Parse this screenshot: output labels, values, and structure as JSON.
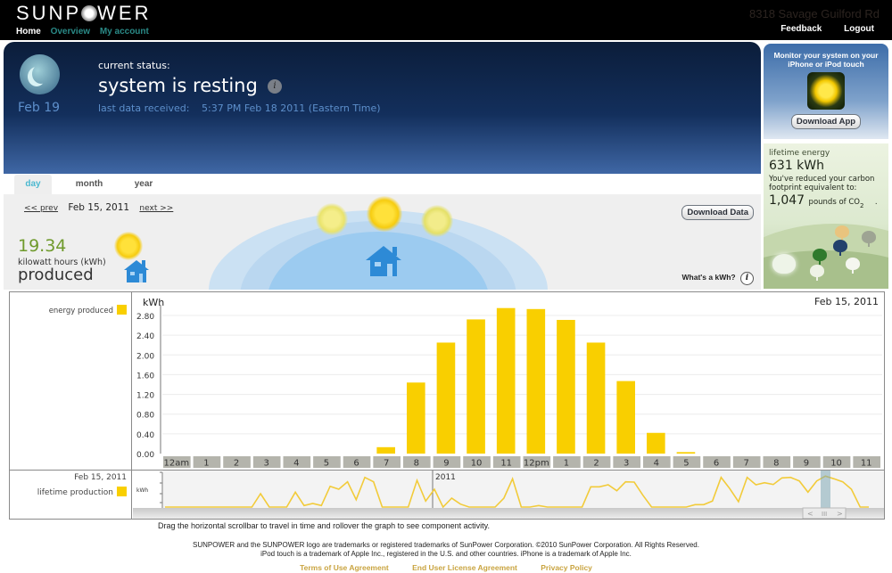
{
  "header": {
    "brand": "SUNPOWER",
    "nav": [
      "Home",
      "Overview",
      "My account"
    ],
    "active_nav": "Home",
    "address": "8318 Savage Guilford Rd",
    "feedback": "Feedback",
    "logout": "Logout"
  },
  "status": {
    "date": "Feb 19",
    "label": "current status:",
    "value": "system is resting",
    "info_icon": "i",
    "last_data_label": "last data received:",
    "last_data_value": "5:37 PM Feb 18 2011 (Eastern Time)"
  },
  "app_promo": {
    "text": "Monitor your system on your iPhone or iPod touch",
    "button": "Download App"
  },
  "lifetime": {
    "title": "lifetime energy",
    "value": "631 kWh",
    "desc": "You've reduced your carbon footprint equivalent to:",
    "co2_value": "1,047",
    "co2_unit": "pounds of CO",
    "co2_sub": "2",
    "co2_tail": "."
  },
  "tabs": [
    {
      "label": "day",
      "active": true
    },
    {
      "label": "month",
      "active": false
    },
    {
      "label": "year",
      "active": false
    }
  ],
  "day": {
    "prev": "<< prev",
    "date": "Feb 15, 2011",
    "next": "next >>",
    "produced_value": "19.34",
    "produced_unit": "kilowatt hours (kWh)",
    "produced_label": "produced",
    "download_data": "Download Data",
    "whats_kwh": "What's a kWh?",
    "info_icon": "i"
  },
  "chart_legend": {
    "energy": "energy produced",
    "mini_date": "Feb 15, 2011",
    "lifetime": "lifetime production",
    "energy_color": "#f9cf00"
  },
  "chart_data": {
    "type": "bar",
    "title": "Feb 15, 2011",
    "ylabel": "kWh",
    "xlabel": "",
    "ylim": [
      0,
      2.8
    ],
    "yticks": [
      "0.00",
      "0.40",
      "0.80",
      "1.20",
      "1.60",
      "2.00",
      "2.40",
      "2.80"
    ],
    "grid": true,
    "legend": "left",
    "categories": [
      "12am",
      "1",
      "2",
      "3",
      "4",
      "5",
      "6",
      "7",
      "8",
      "9",
      "10",
      "11",
      "12pm",
      "1",
      "2",
      "3",
      "4",
      "5",
      "6",
      "7",
      "8",
      "9",
      "10",
      "11"
    ],
    "series": [
      {
        "name": "energy produced",
        "color": "#f9cf00",
        "values": [
          0,
          0,
          0,
          0,
          0,
          0,
          0,
          0.13,
          1.44,
          2.25,
          2.72,
          2.95,
          2.93,
          2.71,
          2.25,
          1.47,
          0.42,
          0.03,
          0,
          0,
          0,
          0,
          0,
          0
        ]
      }
    ]
  },
  "mini_chart": {
    "type": "line",
    "ylabel": "kWh",
    "year_marker": "2011",
    "color": "#f2cb3a",
    "values": [
      0,
      0,
      0,
      0,
      0,
      0,
      0,
      0,
      0,
      0,
      0,
      0.45,
      0,
      0,
      0,
      0.5,
      0.05,
      0.12,
      0.05,
      0.7,
      0.6,
      0.85,
      0.25,
      1,
      0.85,
      0,
      0,
      0,
      0,
      0.9,
      0.2,
      0.6,
      0,
      0.3,
      0.1,
      0,
      0,
      0,
      0,
      0.3,
      0.95,
      0,
      0,
      0.05,
      0,
      0,
      0,
      0,
      0,
      0.68,
      0.68,
      0.75,
      0.55,
      0.85,
      0.84,
      0.4,
      0,
      0,
      0,
      0,
      0,
      0.08,
      0.08,
      0.2,
      1.0,
      0.62,
      0.18,
      1.0,
      0.75,
      0.82,
      0.76,
      0.98,
      1.0,
      0.88,
      0.5,
      0.88,
      1.04,
      0.95,
      0.85,
      0.6,
      0,
      0
    ],
    "scrollbar": {
      "left": "<",
      "grip": "III",
      "right": ">"
    }
  },
  "hint": "Drag the horizontal scrollbar to travel in time and rollover the graph to see component activity.",
  "footer": {
    "line1": "SUNPOWER and the SUNPOWER logo are trademarks or registered trademarks of SunPower Corporation. ©2010 SunPower Corporation. All Rights Reserved.",
    "line2": "iPod touch is a trademark of Apple Inc., registered in the U.S. and other countries.  iPhone is a trademark of Apple Inc.",
    "links": [
      "Terms of Use Agreement",
      "End User License Agreement",
      "Privacy Policy"
    ]
  }
}
